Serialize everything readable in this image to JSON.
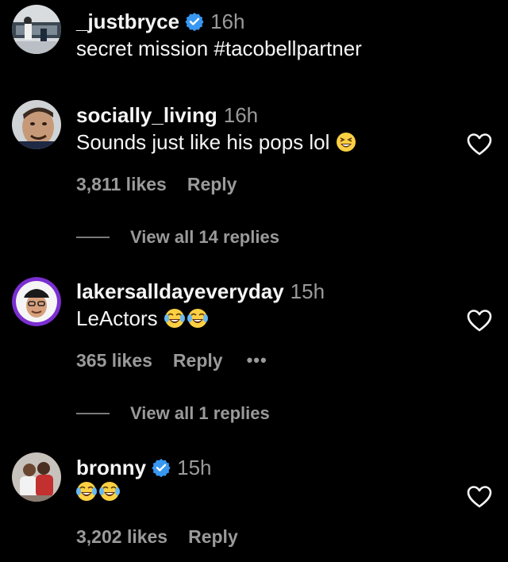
{
  "comments": [
    {
      "username": "_justbryce",
      "verified": true,
      "time": "16h",
      "text": "secret mission #tacobellpartner",
      "emoji": ""
    },
    {
      "username": "socially_living",
      "verified": false,
      "time": "16h",
      "text": "Sounds just like his pops lol",
      "emoji": "grinning-squinting-face",
      "likes": "3,811 likes",
      "reply": "Reply",
      "view_replies": "View all 14 replies"
    },
    {
      "username": "lakersalldayeveryday",
      "verified": false,
      "time": "15h",
      "text": "LeActors",
      "emoji": "tears-of-joy x2",
      "likes": "365 likes",
      "reply": "Reply",
      "more": "•••",
      "view_replies": "View all 1 replies"
    },
    {
      "username": "bronny",
      "verified": true,
      "time": "15h",
      "text": "",
      "emoji": "tears-of-joy x2",
      "likes": "3,202 likes",
      "reply": "Reply"
    }
  ],
  "colors": {
    "background": "#000000",
    "text": "#f5f5f5",
    "muted": "#9a9a9a",
    "verified": "#3897f0"
  }
}
